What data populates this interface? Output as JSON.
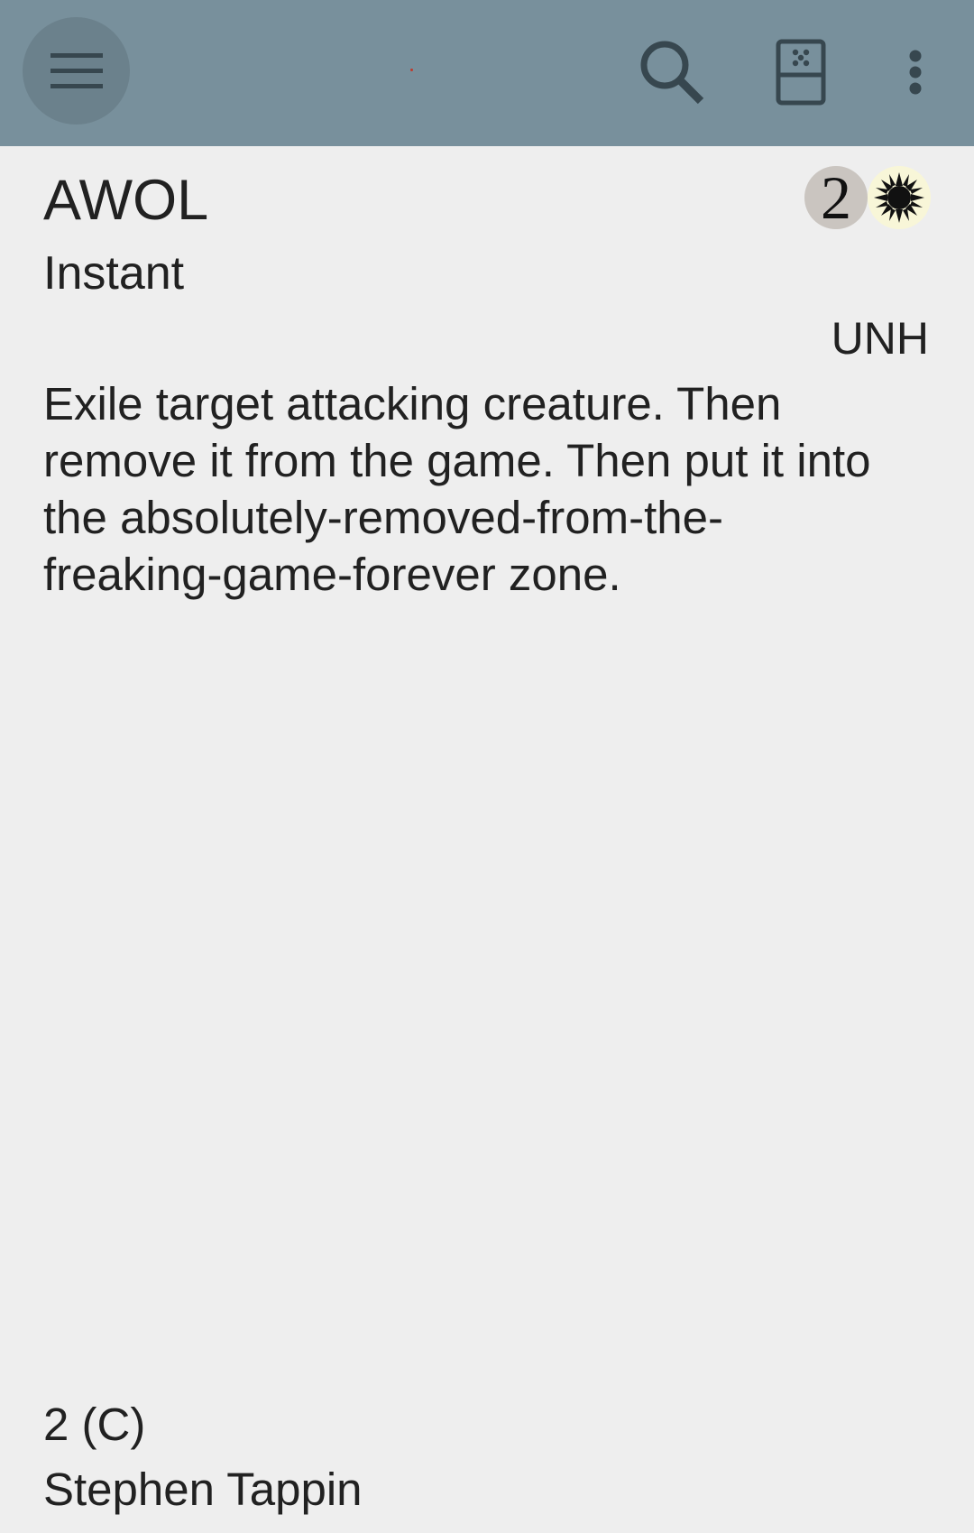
{
  "toolbar": {
    "menu_icon": "hamburger-menu-icon",
    "search_icon": "search-icon",
    "random_icon": "dice-icon",
    "overflow_icon": "more-vertical-icon",
    "background": "#78909c"
  },
  "card": {
    "name": "AWOL",
    "mana_cost": {
      "generic": "2",
      "colored_symbol": "white-mana-icon"
    },
    "type_line": "Instant",
    "set_code": "UNH",
    "oracle_text": "Exile target attacking creature. Then remove it from the game. Then put it into the absolutely-removed-from-the-freaking-game-forever zone.",
    "number_rarity": "2 (C)",
    "artist": "Stephen Tappin"
  }
}
